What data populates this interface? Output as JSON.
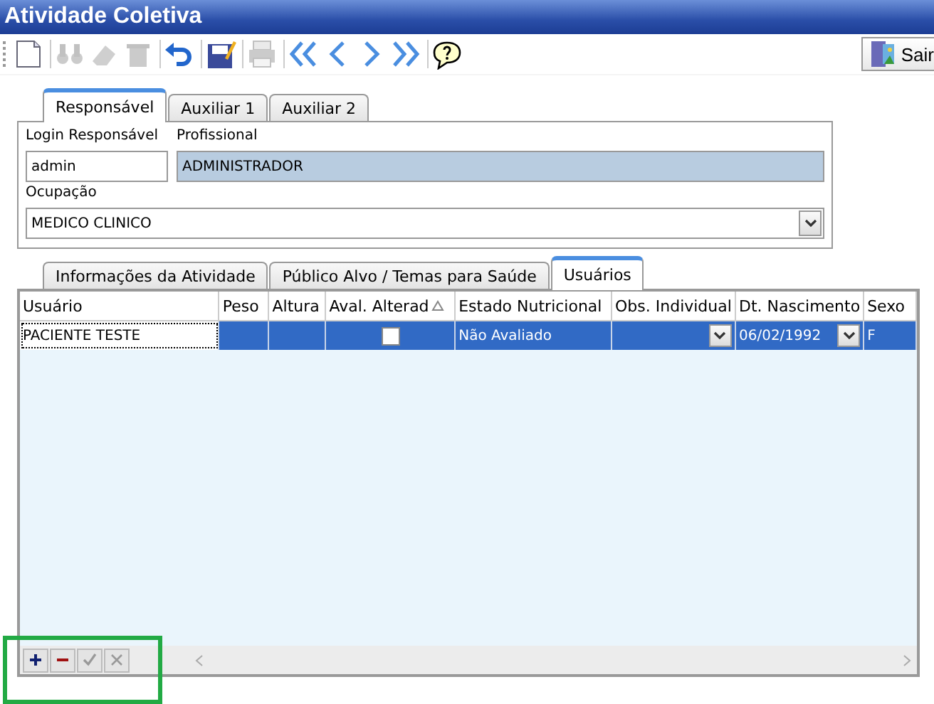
{
  "window": {
    "title": "Atividade Coletiva"
  },
  "toolbar": [
    {
      "kind": "new",
      "disabled": false
    },
    {
      "kind": "find",
      "disabled": true
    },
    {
      "kind": "erase",
      "disabled": true
    },
    {
      "kind": "delete",
      "disabled": true
    },
    {
      "kind": "undo",
      "disabled": false
    },
    {
      "kind": "save",
      "disabled": false
    },
    {
      "kind": "print",
      "disabled": true
    },
    {
      "kind": "first",
      "disabled": false
    },
    {
      "kind": "prev",
      "disabled": false
    },
    {
      "kind": "next",
      "disabled": false
    },
    {
      "kind": "last",
      "disabled": false
    },
    {
      "kind": "help",
      "disabled": false
    }
  ],
  "exit_button": {
    "label": "Sair"
  },
  "top_tabs": [
    {
      "label": "Responsável",
      "selected": true
    },
    {
      "label": "Auxiliar 1",
      "selected": false
    },
    {
      "label": "Auxiliar 2",
      "selected": false
    }
  ],
  "login": {
    "label": "Login Responsável",
    "value": "admin"
  },
  "professional": {
    "label": "Profissional",
    "value": "ADMINISTRADOR",
    "disabled": true
  },
  "occupation": {
    "label": "Ocupação",
    "value": "MEDICO CLINICO"
  },
  "bottom_tabs": [
    {
      "label": "Informações da Atividade",
      "selected": false
    },
    {
      "label": "Público Alvo / Temas para Saúde",
      "selected": false
    },
    {
      "label": "Usuários",
      "selected": true
    }
  ],
  "grid": {
    "columns": [
      {
        "label": "Usuário",
        "sorted": false
      },
      {
        "label": "Peso",
        "sorted": false
      },
      {
        "label": "Altura",
        "sorted": false
      },
      {
        "label": "Aval. Alterad",
        "sorted": true
      },
      {
        "label": "Estado Nutricional",
        "sorted": false
      },
      {
        "label": "Obs. Individual",
        "sorted": false
      },
      {
        "label": "Dt. Nascimento",
        "sorted": false
      },
      {
        "label": "Sexo",
        "sorted": false
      }
    ],
    "rows": [
      {
        "selected": true,
        "cells": [
          {
            "kind": "text",
            "value": "PACIENTE TESTE"
          },
          {
            "kind": "text"
          },
          {
            "kind": "text"
          },
          {
            "kind": "check",
            "checked": false
          },
          {
            "kind": "text",
            "value": "Não Avaliado"
          },
          {
            "kind": "combo"
          },
          {
            "kind": "combo",
            "value": "06/02/1992"
          },
          {
            "kind": "text",
            "value": "F"
          }
        ]
      }
    ]
  },
  "navigator": [
    {
      "kind": "add",
      "disabled": false
    },
    {
      "kind": "remove",
      "disabled": false
    },
    {
      "kind": "post",
      "disabled": true
    },
    {
      "kind": "cancel",
      "disabled": true
    }
  ]
}
